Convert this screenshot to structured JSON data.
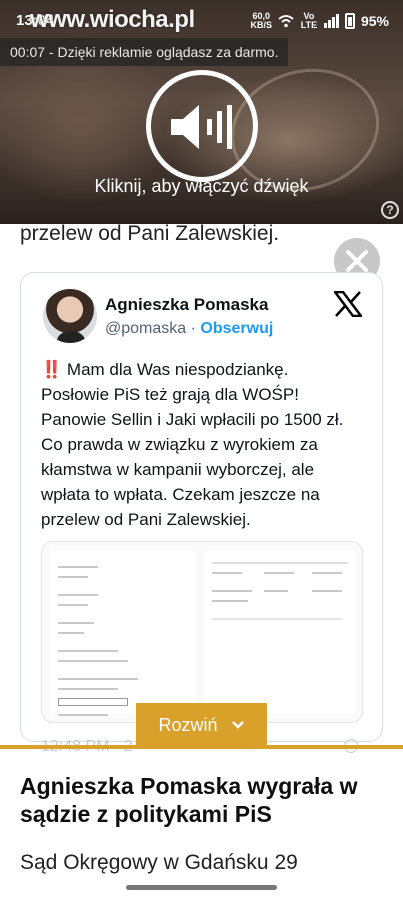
{
  "statusbar": {
    "time": "13:04",
    "site_logo": "www.wiocha.pl",
    "speed": "60,0",
    "speed_unit": "KB/S",
    "network": "Vo LTE",
    "battery": "95%"
  },
  "video": {
    "ad_note": "00:07 - Dzięki reklamie oglądasz za darmo.",
    "unmute_caption": "Kliknij, aby włączyć dźwięk",
    "help_symbol": "?"
  },
  "article": {
    "previous_line": "przelew od Pani Zalewskiej.",
    "headline": "Agnieszka Pomaska wygrała w sądzie z politykami PiS",
    "subtext": "Sąd Okręgowy w Gdańsku 29"
  },
  "tweet": {
    "author_name": "Agnieszka Pomaska",
    "handle": "@pomaska",
    "separator": "·",
    "follow_label": "Obserwuj",
    "warning_glyph": "‼️",
    "body_lines": [
      "Mam dla Was niespodziankę.",
      "Posłowie PiS też grają dla WOŚP!",
      "Panowie Sellin i Jaki wpłacili po 1500 zł.",
      "Co prawda w związku z wyrokiem za",
      "kłamstwa w kampanii wyborczej, ale",
      "wpłata to wpłata. Czekam jeszcze na",
      "przelew od Pani Zalewskiej."
    ],
    "timestamp": "12:48 PM · 2"
  },
  "expand_button": {
    "label": "Rozwiń"
  },
  "colors": {
    "accent_gold": "#d9a02a",
    "twitter_blue": "#1d9bf0"
  }
}
